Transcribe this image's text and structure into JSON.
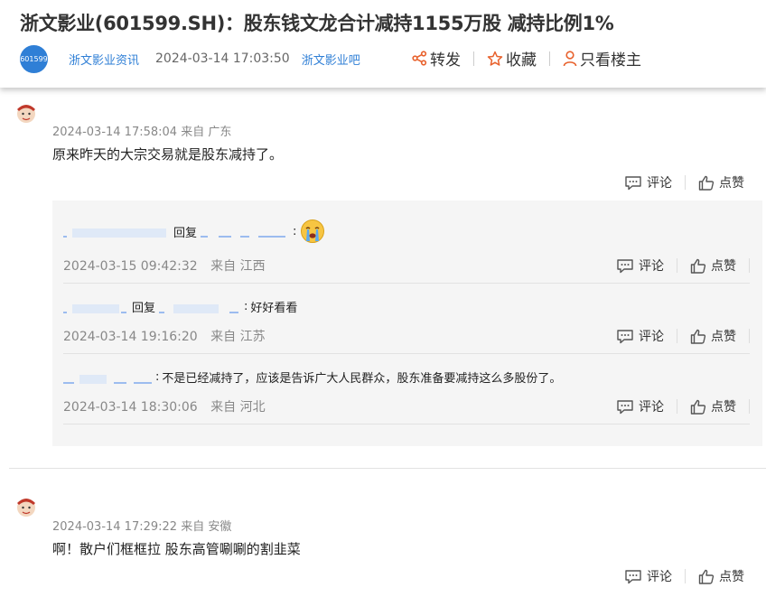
{
  "header": {
    "title": "浙文影业(601599.SH)：股东钱文龙合计减持1155万股 减持比例1%",
    "stock_avatar": "601599",
    "author": "浙文影业资讯",
    "time": "2024-03-14 17:03:50",
    "bar_link": "浙文影业吧",
    "actions": {
      "share": "转发",
      "collect": "收藏",
      "only_op": "只看楼主"
    }
  },
  "comments": [
    {
      "time": "2024-03-14 17:58:04",
      "from": "来自 广东",
      "text": "原来昨天的大宗交易就是股东减持了。",
      "comment_label": "评论",
      "like_label": "点赞",
      "replies": [
        {
          "reply_word": "回复",
          "text": "",
          "time": "2024-03-15 09:42:32",
          "from": "来自 江西",
          "comment_label": "评论",
          "like_label": "点赞"
        },
        {
          "reply_word": "回复",
          "text": "好好看看",
          "time": "2024-03-14 19:16:20",
          "from": "来自 江苏",
          "comment_label": "评论",
          "like_label": "点赞"
        },
        {
          "text": "不是已经减持了，应该是告诉广大人民群众，股东准备要减持这么多股份了。",
          "time": "2024-03-14 18:30:06",
          "from": "来自 河北",
          "comment_label": "评论",
          "like_label": "点赞"
        }
      ]
    },
    {
      "time": "2024-03-14 17:29:22",
      "from": "来自 安徽",
      "text": "啊！散户们框框拉 股东高管唰唰的割韭菜",
      "comment_label": "评论",
      "like_label": "点赞"
    }
  ],
  "icons": {
    "share": "share-icon",
    "collect": "star-icon",
    "only_op": "person-icon",
    "comment": "comment-icon",
    "like": "thumbs-up-icon",
    "emoji": "crying-emoji-icon"
  },
  "colors": {
    "link": "#2f7fd6",
    "accent": "#e8612c"
  }
}
